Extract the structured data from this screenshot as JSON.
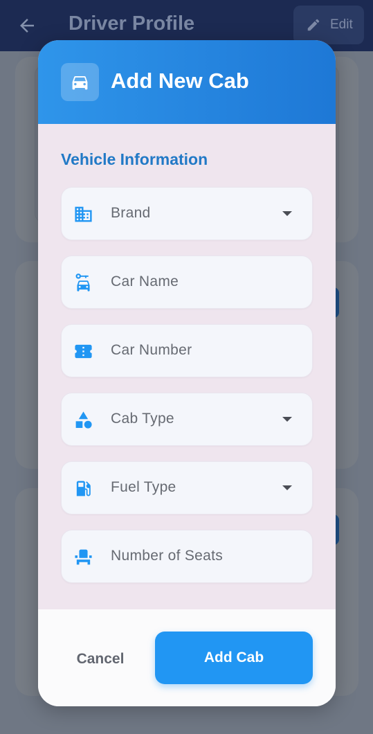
{
  "background_page": {
    "title": "Driver Profile",
    "edit_label": "Edit"
  },
  "dialog": {
    "title": "Add New Cab",
    "section_title": "Vehicle Information",
    "fields": [
      {
        "label": "Brand",
        "icon": "building-icon",
        "dropdown": true
      },
      {
        "label": "Car Name",
        "icon": "car-icon",
        "dropdown": false
      },
      {
        "label": "Car Number",
        "icon": "ticket-icon",
        "dropdown": false
      },
      {
        "label": "Cab Type",
        "icon": "shapes-icon",
        "dropdown": true
      },
      {
        "label": "Fuel Type",
        "icon": "fuel-icon",
        "dropdown": true
      },
      {
        "label": "Number of Seats",
        "icon": "seat-icon",
        "dropdown": false
      }
    ],
    "cancel_label": "Cancel",
    "submit_label": "Add Cab"
  },
  "colors": {
    "primary": "#2196f3",
    "header_gradient_start": "#2f95ea",
    "header_gradient_end": "#1e78d6",
    "section_title": "#2179c6",
    "dialog_body": "#efe5ee"
  }
}
